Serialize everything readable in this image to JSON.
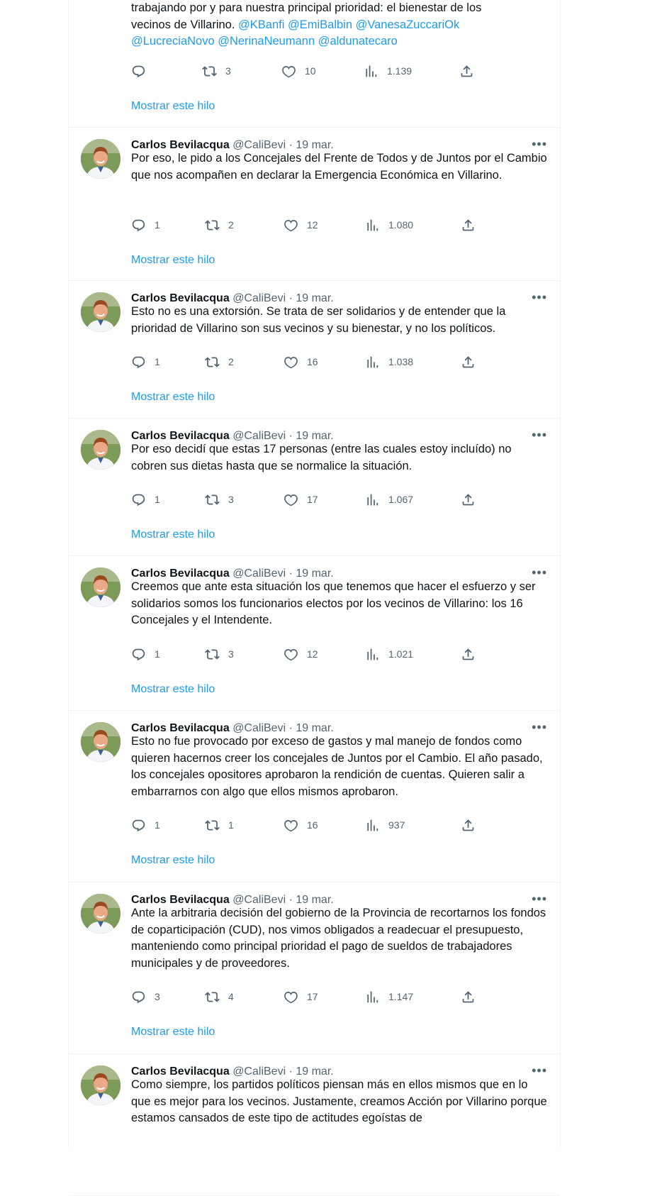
{
  "first_tweet": {
    "text_line1": "trabajando por y para nuestra principal prioridad: el bienestar de los",
    "text_line2_pre": "vecinos de Villarino. ",
    "mentions_line2": "@KBanfi @EmiBalbin @VanesaZuccariOk",
    "mentions_line3": "@LucreciaNovo @NerinaNeumann @aldunatecaro",
    "replies": "",
    "retweets": "3",
    "likes": "10",
    "views": "1.139",
    "show_thread": "Mostrar este hilo"
  },
  "tweets": [
    {
      "name": "Carlos Bevilacqua",
      "handle": "@CaliBevi",
      "sep": "·",
      "date": "19 mar.",
      "text": "Por eso, le pido a los Concejales del Frente de Todos y de Juntos por el Cambio que nos acompañen en declarar la Emergencia Económica en Villarino.",
      "replies": "1",
      "retweets": "2",
      "likes": "12",
      "views": "1.080",
      "show_thread": "Mostrar este hilo"
    },
    {
      "name": "Carlos Bevilacqua",
      "handle": "@CaliBevi",
      "sep": "·",
      "date": "19 mar.",
      "text": "Esto no es una extorsión. Se trata de ser solidarios y de entender que la prioridad de Villarino son sus vecinos y su bienestar, y no los políticos.",
      "replies": "1",
      "retweets": "2",
      "likes": "16",
      "views": "1.038",
      "show_thread": "Mostrar este hilo"
    },
    {
      "name": "Carlos Bevilacqua",
      "handle": "@CaliBevi",
      "sep": "·",
      "date": "19 mar.",
      "text": "Por eso decidí que estas 17 personas (entre las cuales estoy incluído) no cobren sus dietas hasta que se normalice la situación.",
      "replies": "1",
      "retweets": "3",
      "likes": "17",
      "views": "1.067",
      "show_thread": "Mostrar este hilo"
    },
    {
      "name": "Carlos Bevilacqua",
      "handle": "@CaliBevi",
      "sep": "·",
      "date": "19 mar.",
      "text": "Creemos que ante esta situación los que tenemos que hacer el esfuerzo y ser solidarios somos los funcionarios electos por los vecinos de Villarino: los 16 Concejales y el Intendente.",
      "replies": "1",
      "retweets": "3",
      "likes": "12",
      "views": "1.021",
      "show_thread": "Mostrar este hilo"
    },
    {
      "name": "Carlos Bevilacqua",
      "handle": "@CaliBevi",
      "sep": "·",
      "date": "19 mar.",
      "text": "Esto no fue provocado por exceso de gastos y mal manejo de fondos como quieren hacernos creer los concejales de Juntos por el Cambio. El año pasado, los concejales opositores aprobaron la rendición de cuentas. Quieren salir a embarrarnos con algo que ellos mismos aprobaron.",
      "replies": "1",
      "retweets": "1",
      "likes": "16",
      "views": "937",
      "show_thread": "Mostrar este hilo"
    },
    {
      "name": "Carlos Bevilacqua",
      "handle": "@CaliBevi",
      "sep": "·",
      "date": "19 mar.",
      "text": "Ante la arbitraria decisión del gobierno de la Provincia de recortarnos los fondos de coparticipación (CUD), nos vimos obligados a readecuar el presupuesto, manteniendo como principal prioridad el pago de sueldos de trabajadores municipales y de proveedores.",
      "replies": "3",
      "retweets": "4",
      "likes": "17",
      "views": "1.147",
      "show_thread": "Mostrar este hilo"
    },
    {
      "name": "Carlos Bevilacqua",
      "handle": "@CaliBevi",
      "sep": "·",
      "date": "19 mar.",
      "text": "Como siempre, los partidos políticos piensan más en ellos mismos que en lo que es mejor para los vecinos. Justamente, creamos Acción por Villarino porque estamos cansados de este tipo de actitudes egoístas de",
      "replies": "",
      "retweets": "",
      "likes": "",
      "views": "",
      "show_thread": ""
    }
  ],
  "colors": {
    "link": "#1d9bf0",
    "muted": "#536471",
    "text": "#0f1419",
    "border": "#eff3f4"
  },
  "icons": [
    "reply-icon",
    "retweet-icon",
    "like-icon",
    "views-icon",
    "share-icon",
    "more-icon"
  ]
}
